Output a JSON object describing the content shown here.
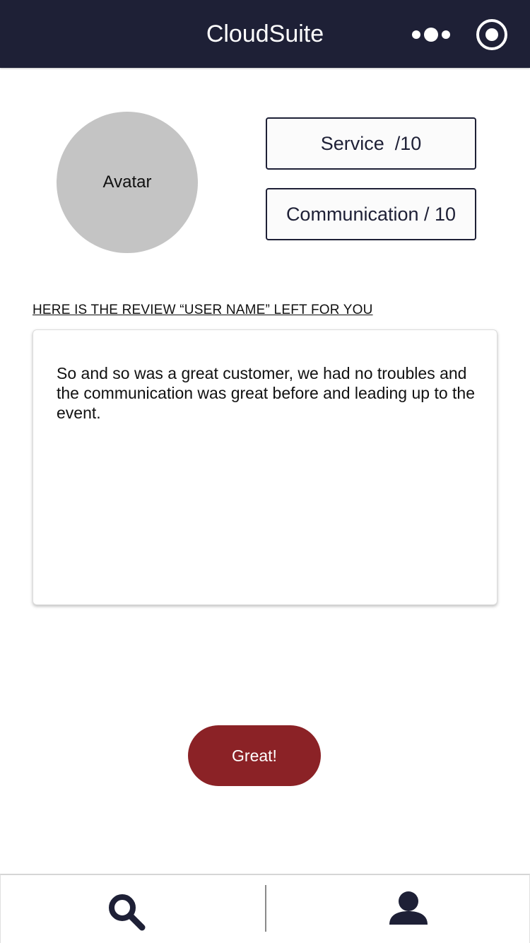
{
  "header": {
    "title": "CloudSuite",
    "more_icon": "more-dots-icon",
    "target_icon": "target-icon",
    "background": "#1e2036"
  },
  "avatar": {
    "label": "Avatar"
  },
  "scores": {
    "service": "Service  /10",
    "communication": "Communication / 10"
  },
  "review": {
    "heading": "HERE IS THE REVIEW “USER NAME” LEFT FOR YOU",
    "text": "So and so was a great customer, we had no troubles and the communication was great before and leading up to the event."
  },
  "actions": {
    "great_label": "Great!",
    "accent": "#8b2226"
  },
  "bottom_nav": {
    "items": [
      {
        "icon": "search-icon"
      },
      {
        "icon": "profile-icon"
      }
    ]
  }
}
